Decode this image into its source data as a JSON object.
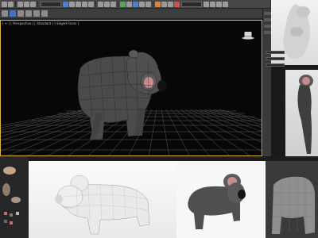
{
  "viewport": {
    "label": "[ + ] [ Perspective ] [ Standard ] [ Edged Faces ]"
  },
  "icons": {
    "toolbar": [
      "undo-icon",
      "redo-icon",
      "link-icon",
      "unlink-icon",
      "bind-icon",
      "select-icon",
      "select-region-icon",
      "move-icon",
      "rotate-icon",
      "scale-icon",
      "snap-icon",
      "angle-snap-icon",
      "mirror-icon",
      "align-icon",
      "layer-icon",
      "render-setup-icon",
      "render-icon"
    ],
    "viewport_hat": "top-hat-icon"
  },
  "colors": {
    "viewport_border": "#d9b43a",
    "viewport_bg": "#070707",
    "grid": "#5a5a5a",
    "koala_gray": "#4a4a4a",
    "koala_ear_pink": "#c98b8b"
  }
}
